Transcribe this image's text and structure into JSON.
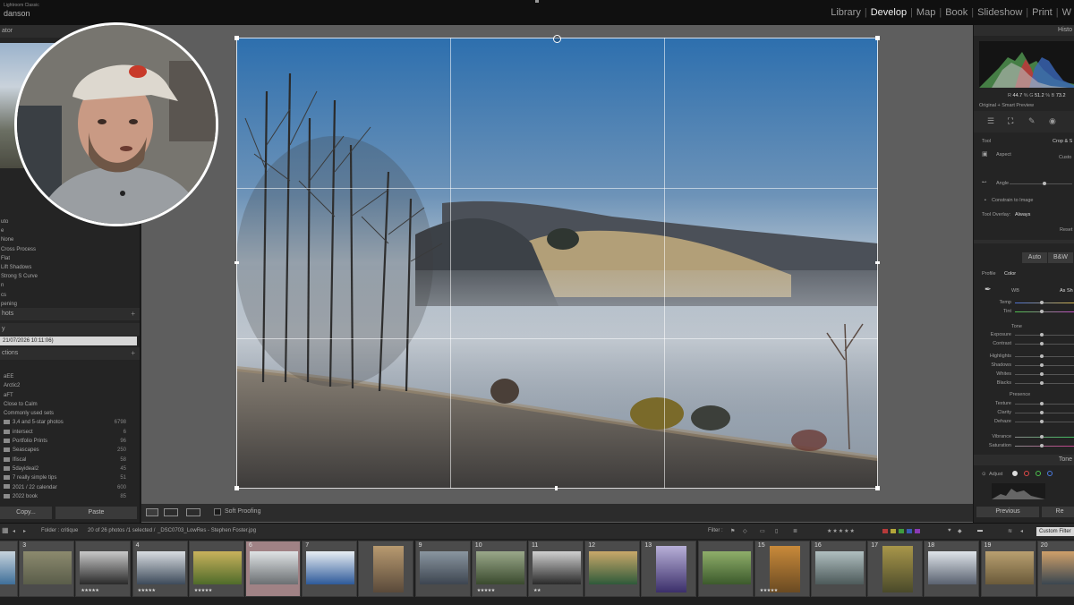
{
  "app": {
    "brand_small": "Lightroom Classic",
    "user_name": "danson"
  },
  "modules": [
    "Library",
    "Develop",
    "Map",
    "Book",
    "Slideshow",
    "Print",
    "W"
  ],
  "active_module": "Develop",
  "left_panel": {
    "navigator_label": "ator",
    "preset_items": [
      "uto",
      "e",
      "None",
      "Cross Process",
      "Flat",
      "Lift Shadows",
      "Strong S Curve",
      "n",
      "cs",
      "pening",
      "etting"
    ],
    "snapshots_label": "hots",
    "history_label": "y",
    "history_selected": "21/07/2026 10:11:06)",
    "collections_label": "ctions",
    "collections": [
      {
        "name": "aEE",
        "count": ""
      },
      {
        "name": "Arctic2",
        "count": ""
      },
      {
        "name": "aFT",
        "count": ""
      },
      {
        "name": "Close to Calm",
        "count": ""
      },
      {
        "name": "Commonly used sets",
        "count": ""
      },
      {
        "name": "3,4 and 5-star photos",
        "count": "6798"
      },
      {
        "name": "intersect",
        "count": "6"
      },
      {
        "name": "Portfolio Prints",
        "count": "96"
      },
      {
        "name": "Seascapes",
        "count": "250"
      },
      {
        "name": "Ifiscal",
        "count": "58"
      },
      {
        "name": "5dayideal2",
        "count": "45"
      },
      {
        "name": "7 really simple tips",
        "count": "51"
      },
      {
        "name": "2021 / 22 calendar",
        "count": "600"
      },
      {
        "name": "2022 book",
        "count": "85"
      }
    ],
    "copy_button": "Copy...",
    "paste_button": "Paste"
  },
  "toolbar": {
    "soft_proofing_label": "Soft Proofing"
  },
  "right_panel": {
    "histogram_label": "Histo",
    "rgb_readout": {
      "r_label": "R",
      "r": "44.7",
      "g_label": "G",
      "g": "51.2",
      "b_label": "B",
      "b": "73.2"
    },
    "preview_label": "Original + Smart Preview",
    "tool_label": "Tool",
    "tool_value": "Crop & S",
    "aspect_label": "Aspect",
    "aspect_value": "Custo",
    "angle_label": "Angle",
    "constrain_label": "Constrain to Image",
    "tool_overlay_label": "Tool Overlay:",
    "tool_overlay_value": "Always",
    "reset_label": "Reset",
    "auto_button": "Auto",
    "bw_button": "B&W",
    "profile_label": "Profile",
    "profile_value": "Color",
    "wb_label": "WB",
    "wb_value": "As Sh",
    "temp_label": "Temp",
    "tint_label": "Tint",
    "tone_label": "Tone",
    "exposure_label": "Exposure",
    "contrast_label": "Contrast",
    "highlights_label": "Highlights",
    "shadows_label": "Shadows",
    "whites_label": "Whites",
    "blacks_label": "Blacks",
    "presence_label": "Presence",
    "texture_label": "Texture",
    "clarity_label": "Clarity",
    "dehaze_label": "Dehaze",
    "vibrance_label": "Vibrance",
    "saturation_label": "Saturation",
    "tonecurve_label": "Tone",
    "adjust_label": "Adjust",
    "previous_button": "Previous",
    "reset_button": "Re"
  },
  "filter_bar": {
    "folder_text": "Folder : critique",
    "count_text": "20 of 26 photos /1 selected /",
    "filename_text": "_DSC0703_LowRes - Stephen Foster.jpg",
    "filter_label": "Filter :",
    "custom_filter": "Custom Filter",
    "label_colors": [
      "#b53a3a",
      "#b3a53a",
      "#3f9b3f",
      "#3a5bb3",
      "#8a3ab3"
    ]
  },
  "filmstrip": {
    "cells": [
      {
        "num": "",
        "stars": "",
        "selected": false,
        "tall": false
      },
      {
        "num": "3",
        "stars": "",
        "selected": false,
        "tall": false
      },
      {
        "num": "",
        "stars": "★★★★★",
        "selected": false,
        "tall": false
      },
      {
        "num": "4",
        "stars": "★★★★★",
        "selected": false,
        "tall": false
      },
      {
        "num": "",
        "stars": "★★★★★",
        "selected": false,
        "tall": false
      },
      {
        "num": "6",
        "stars": "",
        "selected": true,
        "tall": false
      },
      {
        "num": "7",
        "stars": "",
        "selected": false,
        "tall": false
      },
      {
        "num": "",
        "stars": "",
        "selected": false,
        "tall": true
      },
      {
        "num": "9",
        "stars": "",
        "selected": false,
        "tall": false
      },
      {
        "num": "10",
        "stars": "★★★★★",
        "selected": false,
        "tall": false
      },
      {
        "num": "11",
        "stars": "★★",
        "selected": false,
        "tall": false
      },
      {
        "num": "12",
        "stars": "",
        "selected": false,
        "tall": false
      },
      {
        "num": "13",
        "stars": "",
        "selected": false,
        "tall": true
      },
      {
        "num": "",
        "stars": "",
        "selected": false,
        "tall": false
      },
      {
        "num": "15",
        "stars": "★★★★★",
        "selected": false,
        "tall": true
      },
      {
        "num": "16",
        "stars": "",
        "selected": false,
        "tall": false
      },
      {
        "num": "17",
        "stars": "",
        "selected": false,
        "tall": true
      },
      {
        "num": "18",
        "stars": "",
        "selected": false,
        "tall": false
      },
      {
        "num": "19",
        "stars": "",
        "selected": false,
        "tall": false
      },
      {
        "num": "20",
        "stars": "",
        "selected": false,
        "tall": false
      }
    ]
  }
}
